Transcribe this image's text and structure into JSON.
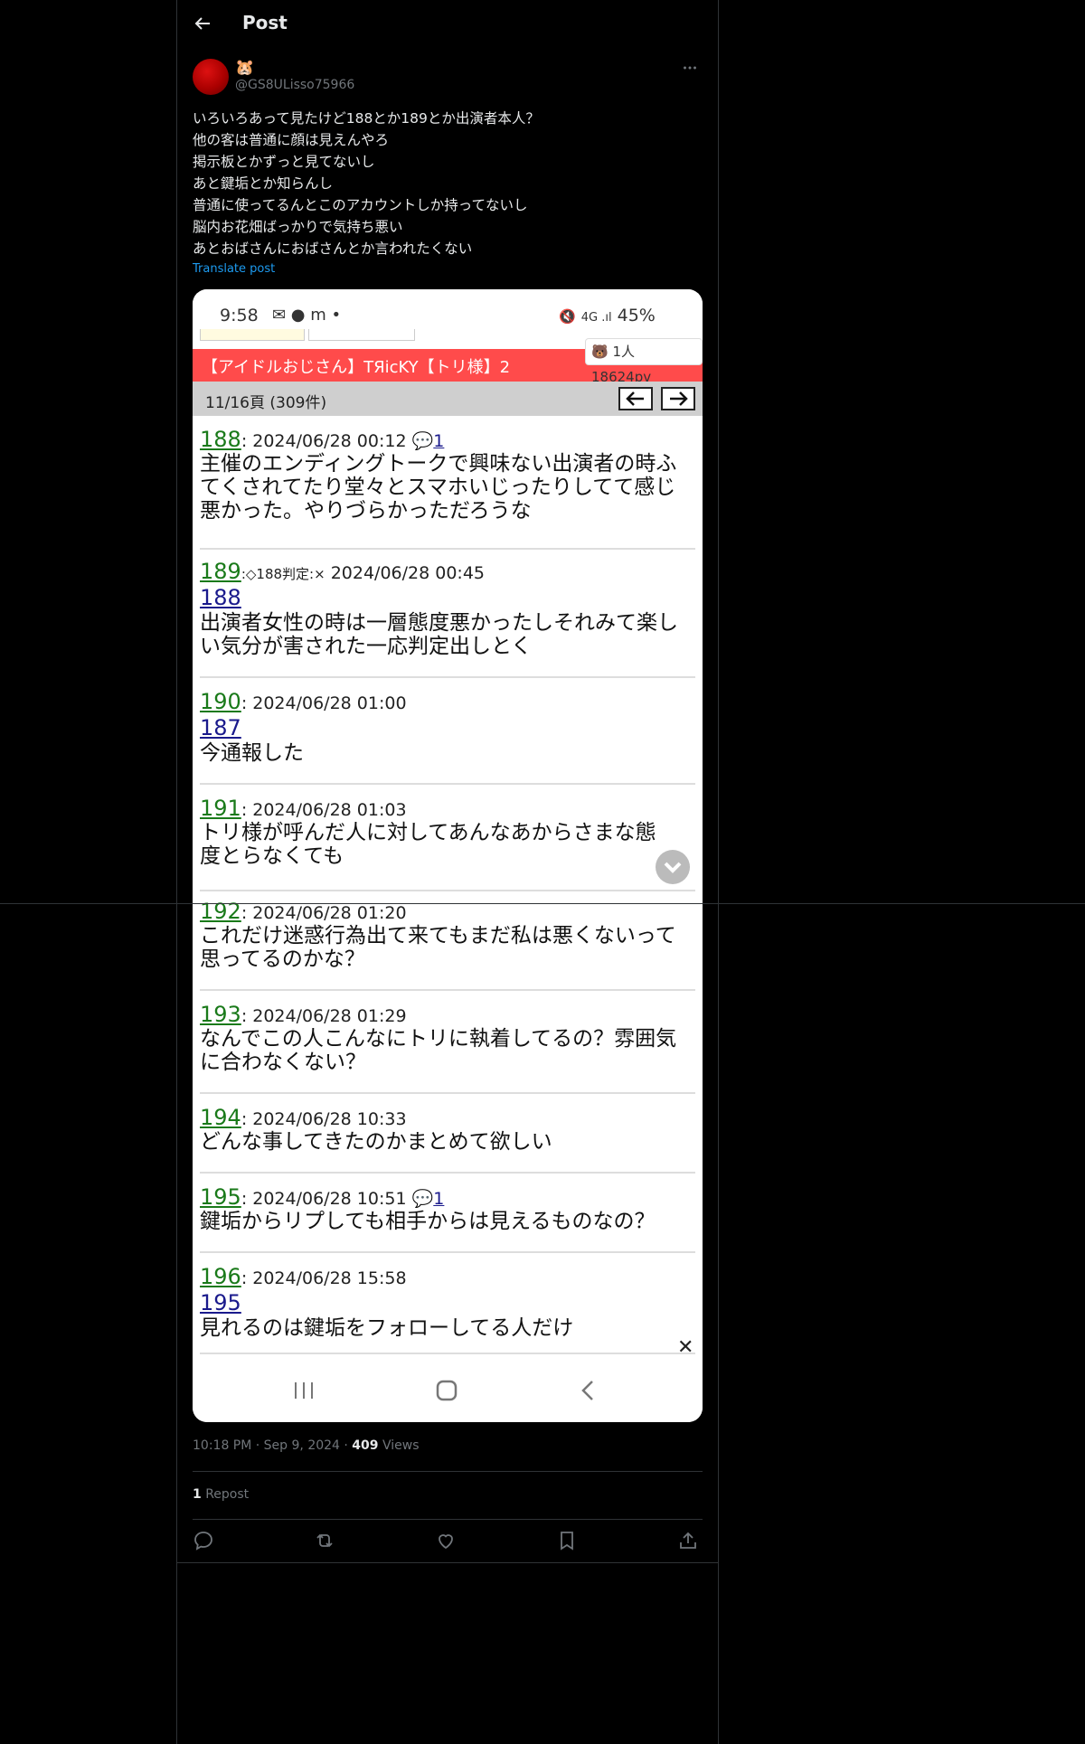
{
  "header": {
    "title": "Post"
  },
  "author": {
    "name_emoji": "🐹",
    "handle": "@GS8ULisso75966"
  },
  "post": {
    "lines": [
      "いろいろあって見たけど188とか189とか出演者本人？",
      "他の客は普通に顔は見えんやろ",
      "掲示板とかずっと見てないし",
      "あと鍵垢とか知らんし",
      "普通に使ってるんとこのアカウントしか持ってないし",
      "脳内お花畑ばっかりで気持ち悪い",
      "あとおばさんにおばさんとか言われたくない"
    ],
    "translate_label": "Translate post"
  },
  "screenshot": {
    "status_time": "9:58",
    "status_right": "45%",
    "thread_title": "【アイドルおじさん】TЯicKY【トリ様】2",
    "counter": "1人 18624pv",
    "page_info": "11/16頁 (309件)",
    "responses": [
      {
        "num": "188",
        "date": ": 2024/06/28 00:12",
        "reply_count": "1",
        "anchor": "",
        "judge": "",
        "body": "主催のエンディングトークで興味ない出演者の時ふてくされてたり堂々とスマホいじったりしてて感じ悪かった。やりづらかっただろうな"
      },
      {
        "num": "189",
        "date": " 2024/06/28 00:45",
        "reply_count": "",
        "anchor": "188",
        "judge": ":◇188判定:×",
        "body": "出演者女性の時は一層態度悪かったしそれみて楽しい気分が害された一応判定出しとく"
      },
      {
        "num": "190",
        "date": ": 2024/06/28 01:00",
        "reply_count": "",
        "anchor": "187",
        "judge": "",
        "body": "今通報した"
      },
      {
        "num": "191",
        "date": ": 2024/06/28 01:03",
        "reply_count": "",
        "anchor": "",
        "judge": "",
        "body": "トリ様が呼んだ人に対してあんなあからさまな態度とらなくても"
      },
      {
        "num": "192",
        "date": ": 2024/06/28 01:20",
        "reply_count": "",
        "anchor": "",
        "judge": "",
        "body": "これだけ迷惑行為出て来てもまだ私は悪くないって思ってるのかな？"
      },
      {
        "num": "193",
        "date": ": 2024/06/28 01:29",
        "reply_count": "",
        "anchor": "",
        "judge": "",
        "body": "なんでこの人こんなにトリに執着してるの？雰囲気に合わなくない？"
      },
      {
        "num": "194",
        "date": ": 2024/06/28 10:33",
        "reply_count": "",
        "anchor": "",
        "judge": "",
        "body": "どんな事してきたのかまとめて欲しい"
      },
      {
        "num": "195",
        "date": ": 2024/06/28 10:51",
        "reply_count": "1",
        "anchor": "",
        "judge": "",
        "body": "鍵垢からリプしても相手からは見えるものなの？"
      },
      {
        "num": "196",
        "date": ": 2024/06/28 15:58",
        "reply_count": "",
        "anchor": "195",
        "judge": "",
        "body": "見れるのは鍵垢をフォローしてる人だけ"
      }
    ],
    "close_glyph": "✕"
  },
  "meta": {
    "time": "10:18 PM · Sep 9, 2024 · ",
    "views_count": "409",
    "views_label": " Views"
  },
  "reposts": {
    "count": "1",
    "label": " Repost"
  },
  "colors": {
    "background": "#000000",
    "accent": "#1d9bf0",
    "title_bar": "#ff4b4b"
  }
}
